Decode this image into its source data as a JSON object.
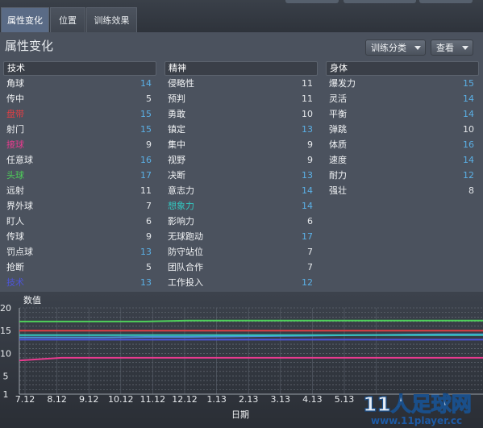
{
  "tabs": [
    {
      "label": "属性变化",
      "active": true
    },
    {
      "label": "位置",
      "active": false
    },
    {
      "label": "训练效果",
      "active": false
    }
  ],
  "page_title": "属性变化",
  "dropdowns": {
    "training": "训练分类",
    "view": "查看"
  },
  "colors": {
    "default_value": "#5bb0e6",
    "dark_value": "#e4e7ea",
    "sepcial_red": "#e03f45",
    "special_pink": "#e83b8f",
    "special_green": "#4ed05a",
    "special_teal": "#33c7c0",
    "special_blue": "#4d55d8"
  },
  "columns": [
    {
      "title": "技术",
      "rows": [
        {
          "name": "角球",
          "value": "14"
        },
        {
          "name": "传中",
          "value": "5"
        },
        {
          "name": "盘带",
          "value": "15"
        },
        {
          "name": "射门",
          "value": "15"
        },
        {
          "name": "接球",
          "value": "9"
        },
        {
          "name": "任意球",
          "value": "16"
        },
        {
          "name": "头球",
          "value": "17"
        },
        {
          "name": "远射",
          "value": "11"
        },
        {
          "name": "界外球",
          "value": "7"
        },
        {
          "name": "盯人",
          "value": "6"
        },
        {
          "name": "传球",
          "value": "9"
        },
        {
          "name": "罚点球",
          "value": "13"
        },
        {
          "name": "抢断",
          "value": "5"
        },
        {
          "name": "技术",
          "value": "13"
        }
      ]
    },
    {
      "title": "精神",
      "rows": [
        {
          "name": "侵略性",
          "value": "11"
        },
        {
          "name": "预判",
          "value": "11"
        },
        {
          "name": "勇敢",
          "value": "10"
        },
        {
          "name": "镇定",
          "value": "13"
        },
        {
          "name": "集中",
          "value": "9"
        },
        {
          "name": "视野",
          "value": "9"
        },
        {
          "name": "决断",
          "value": "13"
        },
        {
          "name": "意志力",
          "value": "14"
        },
        {
          "name": "想象力",
          "value": "14"
        },
        {
          "name": "影响力",
          "value": "6"
        },
        {
          "name": "无球跑动",
          "value": "17"
        },
        {
          "name": "防守站位",
          "value": "7"
        },
        {
          "name": "团队合作",
          "value": "7"
        },
        {
          "name": "工作投入",
          "value": "12"
        }
      ]
    },
    {
      "title": "身体",
      "rows": [
        {
          "name": "爆发力",
          "value": "15"
        },
        {
          "name": "灵活",
          "value": "14"
        },
        {
          "name": "平衡",
          "value": "14"
        },
        {
          "name": "弹跳",
          "value": "10"
        },
        {
          "name": "体质",
          "value": "16"
        },
        {
          "name": "速度",
          "value": "14"
        },
        {
          "name": "耐力",
          "value": "12"
        },
        {
          "name": "强壮",
          "value": "8"
        }
      ]
    }
  ],
  "chart_data": {
    "type": "line",
    "ylabel": "数值",
    "xlabel": "日期",
    "ylim": [
      1,
      20
    ],
    "yticks": [
      1,
      5,
      10,
      15,
      20
    ],
    "categories": [
      "7.12",
      "8.12",
      "9.12",
      "10.12",
      "11.12",
      "12.12",
      "1.13",
      "2.13",
      "3.13",
      "4.13",
      "5.13"
    ],
    "series": [
      {
        "color": "#4ed05a",
        "values": [
          17,
          17,
          17,
          17,
          17.2,
          17.2,
          17.2,
          17.2,
          17.2,
          17.2,
          17.2,
          17.2
        ]
      },
      {
        "color": "#e03f45",
        "values": [
          15,
          15,
          15,
          15,
          15,
          15,
          15,
          15,
          15,
          15,
          15,
          15
        ]
      },
      {
        "color": "#4a90d9",
        "values": [
          13.5,
          13.5,
          13.5,
          13.6,
          13.6,
          13.7,
          13.8,
          13.9,
          14,
          14.1,
          14.2,
          14.2
        ]
      },
      {
        "color": "#33c7c0",
        "values": [
          14,
          14,
          14,
          14,
          14,
          14,
          14,
          14,
          14,
          14,
          14,
          14
        ]
      },
      {
        "color": "#4d55d8",
        "values": [
          13,
          13,
          13,
          13,
          13,
          13,
          13,
          13,
          13,
          13,
          13,
          13
        ]
      },
      {
        "color": "#e83b8f",
        "values": [
          8.4,
          9,
          9,
          9,
          9,
          9,
          9,
          9,
          9,
          9,
          9,
          9
        ]
      }
    ]
  },
  "logo": {
    "title": "11人足球网",
    "url": "www.11player.cc"
  }
}
